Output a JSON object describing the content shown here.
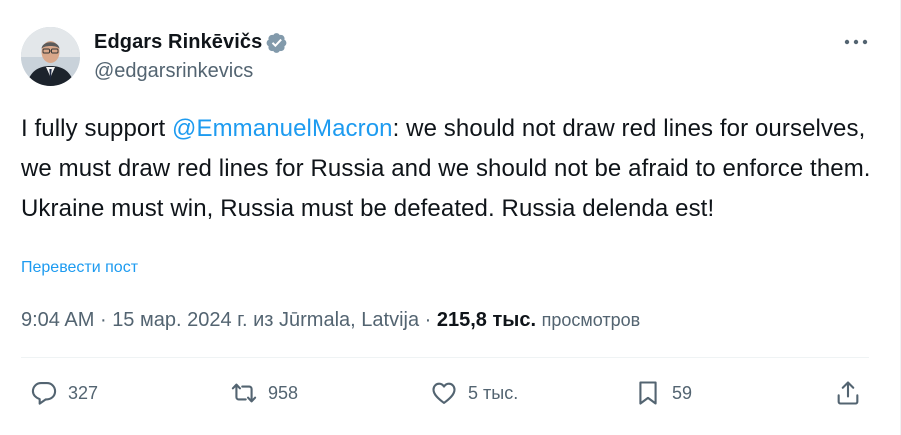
{
  "author": {
    "display_name": "Edgars Rinkēvičs",
    "handle": "@edgarsrinkevics",
    "verified_icon": "verified-badge-icon"
  },
  "tweet": {
    "text_before_mention": "I fully support ",
    "mention": "@EmmanuelMacron",
    "text_after_mention": ": we should not draw red lines for ourselves, we must draw red lines for Russia and we should not be afraid to enforce them. Ukraine must win, Russia must be defeated. Russia delenda est!",
    "translate_label": "Перевести пост"
  },
  "meta": {
    "time": "9:04 AM",
    "date": "15 мар. 2024 г. из Jūrmala, Latvija",
    "views_count": "215,8 тыс.",
    "views_label": "просмотров"
  },
  "actions": {
    "replies": "327",
    "retweets": "958",
    "likes": "5 тыс.",
    "bookmarks": "59"
  },
  "colors": {
    "accent": "#1d9bf0",
    "text": "#0f1419",
    "secondary": "#536471"
  }
}
